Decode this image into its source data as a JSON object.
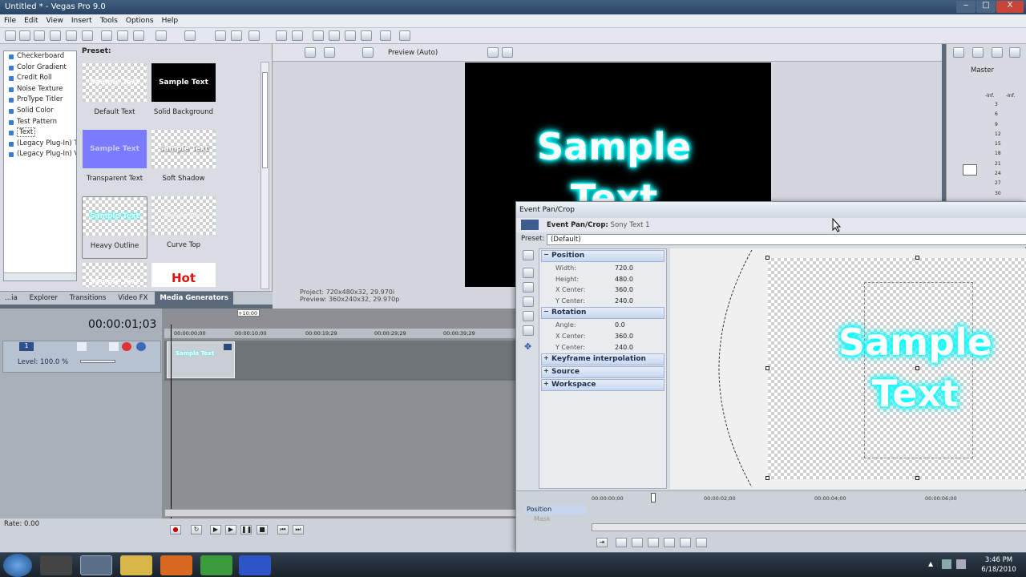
{
  "window": {
    "title": "Untitled * - Vegas Pro 9.0",
    "controls": {
      "minimize": "‒",
      "maximize": "□",
      "close": "X"
    }
  },
  "menu": [
    "File",
    "Edit",
    "View",
    "Insert",
    "Tools",
    "Options",
    "Help"
  ],
  "media_generators": {
    "tree": [
      "Checkerboard",
      "Color Gradient",
      "Credit Roll",
      "Noise Texture",
      "ProType Titler",
      "Solid Color",
      "Test Pattern",
      "Text",
      "(Legacy Plug-In) T",
      "(Legacy Plug-In) V"
    ],
    "selected": "Text",
    "preset_label": "Preset:",
    "presets": [
      {
        "thumb": "Sample Text",
        "name": "Default Text"
      },
      {
        "thumb": "Sample Text",
        "name": "Solid Background"
      },
      {
        "thumb": "Sample Text",
        "name": "Transparent Text"
      },
      {
        "thumb": "Sample Text",
        "name": "Soft Shadow"
      },
      {
        "thumb": "Sample Text",
        "name": "Heavy Outline"
      },
      {
        "thumb": "Sample Text",
        "name": "Curve Top"
      },
      {
        "thumb": "Sample Text",
        "name": ""
      },
      {
        "thumb": "Hot",
        "name": ""
      }
    ],
    "tabs": [
      "...ia",
      "Explorer",
      "Transitions",
      "Video FX",
      "Media Generators"
    ],
    "active_tab": "Media Generators"
  },
  "preview": {
    "mode": "Preview (Auto)",
    "video_text_line1": "Sample",
    "video_text_line2": "Text",
    "project_label": "Project:",
    "project_value": "720x480x32, 29.970i",
    "preview_label": "Preview:",
    "preview_value": "360x240x32, 29.970p"
  },
  "mixer": {
    "label": "Master",
    "left": "-Inf.",
    "right": "-Inf.",
    "scale": [
      "3",
      "6",
      "9",
      "12",
      "15",
      "18",
      "21",
      "24",
      "27",
      "30"
    ]
  },
  "timeline": {
    "timecode": "00:00:01;03",
    "marker": "+10:00",
    "ruler": [
      "00:00:00;00",
      "00:00:10;00",
      "00:00:19;29",
      "00:00:29;29",
      "00:00:39;29"
    ],
    "track_number": "1",
    "level": "Level: 100.0 %",
    "clip_text": "Sample Text",
    "rate": "Rate: 0.00"
  },
  "pan_crop": {
    "window_title": "Event Pan/Crop",
    "header_bold": "Event Pan/Crop:",
    "header_rest": " Sony Text 1",
    "preset_label": "Preset:",
    "preset_value": "(Default)",
    "position": {
      "title": "Position",
      "rows": [
        [
          "Width:",
          "720.0"
        ],
        [
          "Height:",
          "480.0"
        ],
        [
          "X Center:",
          "360.0"
        ],
        [
          "Y Center:",
          "240.0"
        ]
      ]
    },
    "rotation": {
      "title": "Rotation",
      "rows": [
        [
          "Angle:",
          "0.0"
        ],
        [
          "X Center:",
          "360.0"
        ],
        [
          "Y Center:",
          "240.0"
        ]
      ]
    },
    "collapsed": [
      "Keyframe interpolation",
      "Source",
      "Workspace"
    ],
    "canvas_text_line1": "Sample",
    "canvas_text_line2": "Text",
    "kf_ruler": [
      "00:00:00;00",
      "00:00:02;00",
      "00:00:04;00",
      "00:00:06;00"
    ],
    "kf_tracks": [
      "Position",
      "Mask"
    ]
  },
  "taskbar": {
    "time": "3:46 PM",
    "date": "6/18/2010"
  }
}
